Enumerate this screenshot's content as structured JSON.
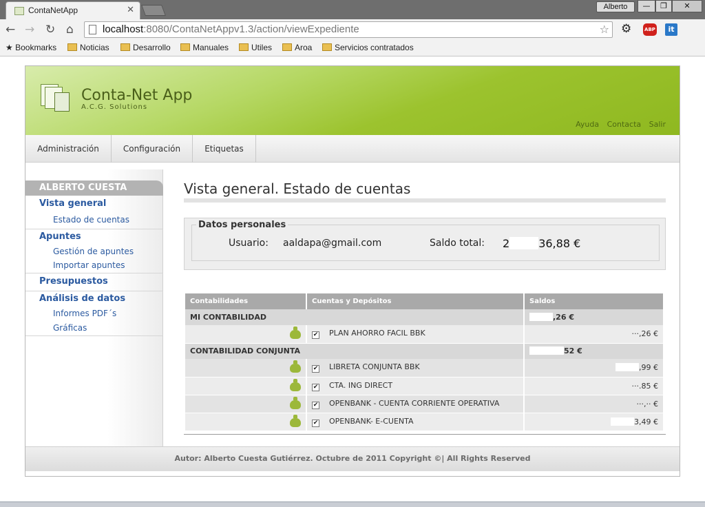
{
  "browser": {
    "tab_title": "ContaNetApp",
    "profile": "Alberto",
    "url_host": "localhost",
    "url_path": ":8080/ContaNetAppv1.3/action/viewExpediente",
    "bookmarks_label": "Bookmarks",
    "bookmarks": [
      "Noticias",
      "Desarrollo",
      "Manuales",
      "Utiles",
      "Aroa",
      "Servicios contratados"
    ],
    "extensions": {
      "abp": "ABP",
      "it": "it"
    }
  },
  "app": {
    "title": "Conta-Net App",
    "subtitle": "A.C.G. Solutions",
    "top_links": [
      "Ayuda",
      "Contacta",
      "Salir"
    ],
    "nav": [
      "Administración",
      "Configuración",
      "Etiquetas"
    ],
    "footer": "Autor: Alberto Cuesta Gutiérrez. Octubre de 2011 Copyright ©| All Rights Reserved"
  },
  "sidebar": {
    "user": "ALBERTO CUESTA",
    "sections": [
      {
        "label": "Vista general",
        "items": [
          "Estado de cuentas"
        ]
      },
      {
        "label": "Apuntes",
        "items": [
          "Gestión de apuntes",
          "Importar apuntes"
        ]
      },
      {
        "label": "Presupuestos",
        "items": []
      },
      {
        "label": "Análisis de datos",
        "items": [
          "Informes PDF´s",
          "Gráficas"
        ]
      }
    ]
  },
  "content": {
    "title": "Vista general. Estado de cuentas",
    "datos": {
      "legend": "Datos personales",
      "usuario_label": "Usuario:",
      "usuario": "aaldapa@gmail.com",
      "saldo_label": "Saldo total:",
      "saldo_prefix": "2",
      "saldo_suffix": "36,88 €"
    },
    "table": {
      "headers": [
        "Contabilidades",
        "Cuentas y Depósitos",
        "Saldos"
      ],
      "groups": [
        {
          "name": "MI CONTABILIDAD",
          "saldo": ",26 €",
          "accounts": [
            {
              "name": "PLAN AHORRO FACIL BBK",
              "saldo": "···,26 €"
            }
          ]
        },
        {
          "name": "CONTABILIDAD CONJUNTA",
          "saldo": "52 €",
          "accounts": [
            {
              "name": "LIBRETA CONJUNTA BBK",
              "saldo": ",99 €"
            },
            {
              "name": "CTA. ING DIRECT",
              "saldo": "···.85 €"
            },
            {
              "name": "OPENBANK - CUENTA CORRIENTE OPERATIVA",
              "saldo": "···,·· €"
            },
            {
              "name": "OPENBANK- E-CUENTA",
              "saldo": "3,49 €"
            }
          ]
        }
      ]
    }
  }
}
